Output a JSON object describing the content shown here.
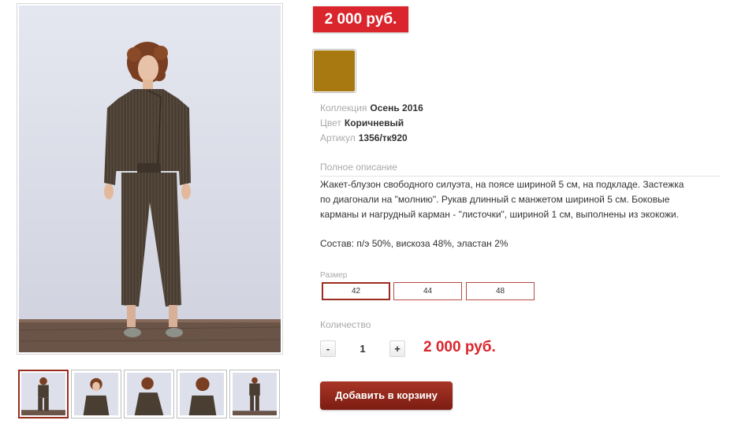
{
  "product": {
    "price_badge": "2 000 руб.",
    "color_swatch": "#a87811",
    "attributes": [
      {
        "label": "Коллекция",
        "value": "Осень 2016"
      },
      {
        "label": "Цвет",
        "value": "Коричневый"
      },
      {
        "label": "Артикул",
        "value": "1356/тк920"
      }
    ],
    "description_title": "Полное описание",
    "description_lines": [
      "Жакет-блузон свободного силуэта, на поясе шириной 5 см, на подкладе. Застежка",
      "по диагонали на \"молнию\". Рукав длинный с манжетом шириной 5 см. Боковые",
      "карманы и нагрудный карман - \"листочки\", шириной 1 см, выполнены из экокожи."
    ],
    "composition": "Состав: п/э 50%, вискоза 48%, эластан 2%",
    "size_label": "Размер",
    "sizes": [
      "42",
      "44",
      "48"
    ],
    "selected_size": "42",
    "quantity_label": "Количество",
    "qty_minus": "-",
    "qty_plus": "+",
    "quantity": "1",
    "total_price": "2 000 руб.",
    "add_to_cart": "Добавить в корзину"
  },
  "gallery": {
    "active_index": 0,
    "thumbnail_count": 5
  }
}
